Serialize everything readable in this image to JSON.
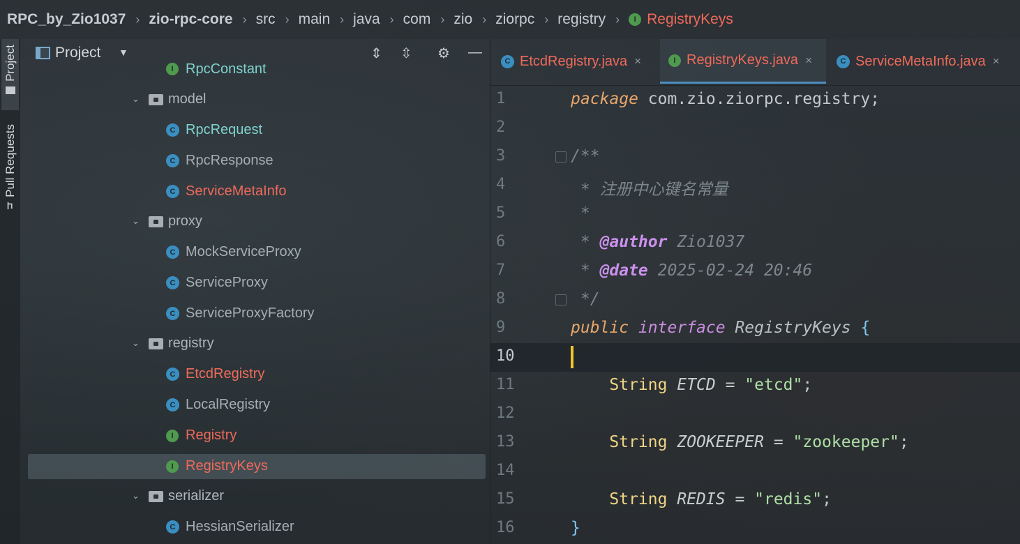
{
  "breadcrumb": {
    "items": [
      "RPC_by_Zio1037",
      "zio-rpc-core",
      "src",
      "main",
      "java",
      "com",
      "zio",
      "ziorpc",
      "registry"
    ],
    "current": "RegistryKeys",
    "current_badge": "I"
  },
  "side_strip": {
    "project_label": "Project",
    "pull_requests_label": "Pull Requests"
  },
  "project_panel": {
    "title": "Project",
    "tree": [
      {
        "kind": "file",
        "badge": "I",
        "label": "RpcConstant",
        "color": "teal"
      },
      {
        "kind": "package",
        "label": "model"
      },
      {
        "kind": "file",
        "badge": "C",
        "label": "RpcRequest",
        "color": "teal"
      },
      {
        "kind": "file",
        "badge": "C",
        "label": "RpcResponse",
        "color": "muted"
      },
      {
        "kind": "file",
        "badge": "C",
        "label": "ServiceMetaInfo",
        "color": "red"
      },
      {
        "kind": "package",
        "label": "proxy"
      },
      {
        "kind": "file",
        "badge": "C",
        "label": "MockServiceProxy",
        "color": "muted"
      },
      {
        "kind": "file",
        "badge": "C",
        "label": "ServiceProxy",
        "color": "muted"
      },
      {
        "kind": "file",
        "badge": "C",
        "label": "ServiceProxyFactory",
        "color": "muted"
      },
      {
        "kind": "package",
        "label": "registry"
      },
      {
        "kind": "file",
        "badge": "C",
        "label": "EtcdRegistry",
        "color": "red"
      },
      {
        "kind": "file",
        "badge": "C",
        "label": "LocalRegistry",
        "color": "muted"
      },
      {
        "kind": "file",
        "badge": "I",
        "label": "Registry",
        "color": "red"
      },
      {
        "kind": "file",
        "badge": "I",
        "label": "RegistryKeys",
        "color": "red",
        "selected": true
      },
      {
        "kind": "package",
        "label": "serializer"
      },
      {
        "kind": "file",
        "badge": "C",
        "label": "HessianSerializer",
        "color": "muted"
      }
    ]
  },
  "editor": {
    "tabs": [
      {
        "label": "EtcdRegistry.java",
        "badge": "C",
        "active": false
      },
      {
        "label": "RegistryKeys.java",
        "badge": "I",
        "active": true
      },
      {
        "label": "ServiceMetaInfo.java",
        "badge": "C",
        "active": false
      }
    ],
    "close_glyph": "×",
    "current_line": 10,
    "code": {
      "l1_kw": "package",
      "l1_rest": " com.zio.ziorpc.registry;",
      "l3": "/**",
      "l4": " * 注册中心键名常量",
      "l5": " *",
      "l6_star": " * ",
      "l6_tag": "@author",
      "l6_val": " Zio1037",
      "l7_star": " * ",
      "l7_tag": "@date",
      "l7_val": " 2025-02-24 20:46",
      "l8": " */",
      "l9_kw": "public",
      "l9_kw2": "interface",
      "l9_name": "RegistryKeys",
      "l9_brace": "{",
      "l11_type": "String",
      "l11_name": "ETCD",
      "l11_eq": " = ",
      "l11_str": "\"etcd\"",
      "l11_end": ";",
      "l13_type": "String",
      "l13_name": "ZOOKEEPER",
      "l13_eq": " = ",
      "l13_str": "\"zookeeper\"",
      "l13_end": ";",
      "l15_type": "String",
      "l15_name": "REDIS",
      "l15_eq": " = ",
      "l15_str": "\"redis\"",
      "l15_end": ";",
      "l16": "}"
    },
    "line_numbers": [
      "1",
      "2",
      "3",
      "4",
      "5",
      "6",
      "7",
      "8",
      "9",
      "10",
      "11",
      "12",
      "13",
      "14",
      "15",
      "16"
    ]
  }
}
